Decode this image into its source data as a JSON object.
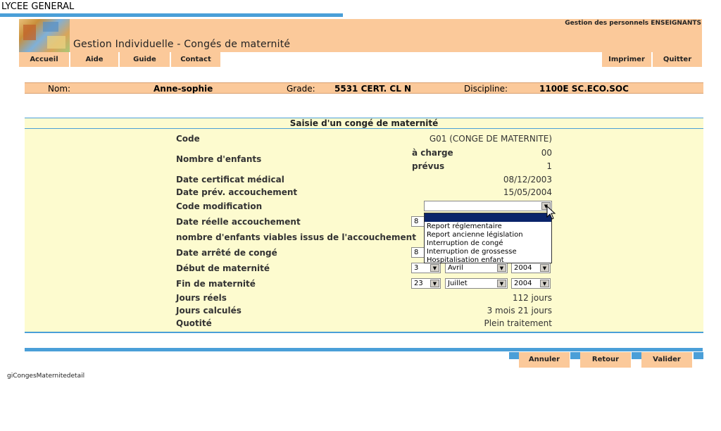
{
  "school": "LYCEE GENERAL",
  "header": {
    "title": "Gestion Individuelle - Congés de maternité",
    "subtitle": "Gestion des personnels ENSEIGNANTS"
  },
  "nav": {
    "left": [
      "Accueil",
      "Aide",
      "Guide",
      "Contact"
    ],
    "right": [
      "Imprimer",
      "Quitter"
    ]
  },
  "person": {
    "nom_label": "Nom:",
    "nom": "Anne-sophie",
    "grade_label": "Grade:",
    "grade": "5531 CERT. CL N",
    "discipline_label": "Discipline:",
    "discipline": "1100E SC.ECO.SOC"
  },
  "form": {
    "title": "Saisie d'un congé de maternité",
    "code_label": "Code",
    "code_value": "G01 (CONGE DE MATERNITE)",
    "enfants_label": "Nombre d'enfants",
    "a_charge_label": "à charge",
    "a_charge": "00",
    "prevus_label": "prévus",
    "prevus": "1",
    "cert_label": "Date certificat médical",
    "cert_value": "08/12/2003",
    "prev_label": "Date prév. accouchement",
    "prev_value": "15/05/2004",
    "modif_label": "Code modification",
    "reelle_label": "Date réelle accouchement",
    "reelle_day": "8",
    "viables_label": "nombre d'enfants viables issus de l'accouchement",
    "arrete_label": "Date arrêté de congé",
    "arrete_day": "8",
    "debut_label": "Début de maternité",
    "debut_day": "3",
    "debut_month": "Avril",
    "debut_year": "2004",
    "fin_label": "Fin de maternité",
    "fin_day": "23",
    "fin_month": "Juillet",
    "fin_year": "2004",
    "jours_reels_label": "Jours réels",
    "jours_reels": "112 jours",
    "jours_calc_label": "Jours calculés",
    "jours_calc": "3 mois 21 jours",
    "quotite_label": "Quotité",
    "quotite": "Plein traitement"
  },
  "dropdown_options": [
    "",
    "Report réglementaire",
    "Report ancienne législation",
    "Interruption de congé",
    "Interruption de grossesse",
    "Hospitalisation enfant"
  ],
  "actions": [
    "Annuler",
    "Retour",
    "Valider"
  ],
  "page_name": "giCongesMaternitedetail",
  "colors": {
    "accent": "#4a9fd8",
    "header_bg": "#fbc99a",
    "panel_bg": "#fdfbcf",
    "highlight": "#0a246a"
  }
}
